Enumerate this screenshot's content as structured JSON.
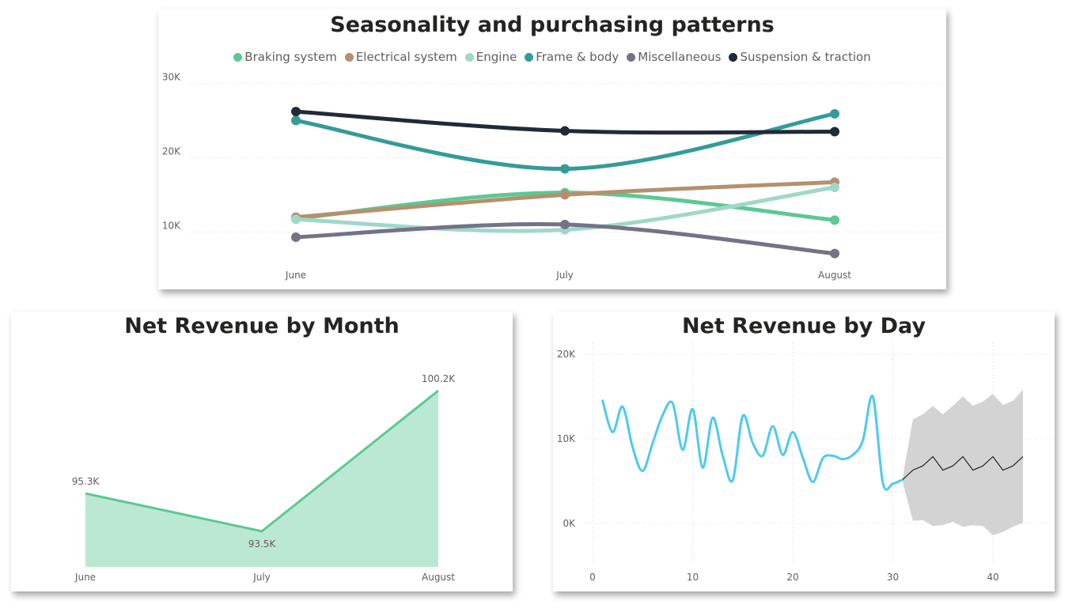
{
  "chart_data": [
    {
      "id": "seasonality",
      "type": "line",
      "title": "Seasonality and purchasing patterns",
      "categories": [
        "June",
        "July",
        "August"
      ],
      "yticks": [
        {
          "value": 10000,
          "label": "10K"
        },
        {
          "value": 20000,
          "label": "20K"
        },
        {
          "value": 30000,
          "label": "30K"
        }
      ],
      "ylim": [
        6000,
        31000
      ],
      "grid": true,
      "legend_position": "top-center",
      "series": [
        {
          "name": "Braking system",
          "color": "#5cc893",
          "values": [
            11800,
            15300,
            11600
          ]
        },
        {
          "name": "Electrical system",
          "color": "#b3916f",
          "values": [
            12000,
            15000,
            16700
          ]
        },
        {
          "name": "Engine",
          "color": "#a0d8c8",
          "values": [
            11700,
            10300,
            16000
          ]
        },
        {
          "name": "Frame & body",
          "color": "#339c97",
          "values": [
            25000,
            18500,
            25900
          ]
        },
        {
          "name": "Miscellaneous",
          "color": "#747386",
          "values": [
            9300,
            11000,
            7100
          ]
        },
        {
          "name": "Suspension & traction",
          "color": "#212b36",
          "values": [
            26200,
            23600,
            23500
          ]
        }
      ]
    },
    {
      "id": "month",
      "type": "area",
      "title": "Net Revenue by Month",
      "categories": [
        "June",
        "July",
        "August"
      ],
      "values": [
        95300,
        93500,
        100200
      ],
      "data_labels": [
        "95.3K",
        "93.5K",
        "100.2K"
      ],
      "ylim": [
        91800,
        100200
      ],
      "color": "#5cc893",
      "fill": "#bbe8d3"
    },
    {
      "id": "day",
      "type": "line",
      "title": "Net Revenue by Day",
      "xticks": [
        {
          "value": 0,
          "label": "0"
        },
        {
          "value": 10,
          "label": "10"
        },
        {
          "value": 20,
          "label": "20"
        },
        {
          "value": 30,
          "label": "30"
        },
        {
          "value": 40,
          "label": "40"
        }
      ],
      "yticks": [
        {
          "value": 0,
          "label": "0K"
        },
        {
          "value": 10000,
          "label": "10K"
        },
        {
          "value": 20000,
          "label": "20K"
        }
      ],
      "xlim": [
        0,
        43
      ],
      "ylim": [
        -6500,
        21000
      ],
      "grid": true,
      "actual": {
        "color": "#4ecaed",
        "x": [
          1,
          2,
          3,
          4,
          5,
          6,
          7,
          8,
          9,
          10,
          11,
          12,
          13,
          14,
          15,
          16,
          17,
          18,
          19,
          20,
          21,
          22,
          23,
          24,
          25,
          26,
          27,
          28,
          29,
          30,
          31
        ],
        "y": [
          14500,
          10800,
          13800,
          9000,
          6200,
          9500,
          12800,
          14200,
          8700,
          13500,
          6600,
          12500,
          8000,
          5100,
          12700,
          9500,
          8000,
          11500,
          8100,
          10800,
          7800,
          4900,
          7700,
          8000,
          7600,
          8100,
          9800,
          15000,
          4800,
          4700,
          5200
        ]
      },
      "forecast": {
        "color": "#252423",
        "band_color": "#d3d3d3",
        "x": [
          31,
          32,
          33,
          34,
          35,
          36,
          37,
          38,
          39,
          40,
          41,
          42,
          43
        ],
        "y": [
          5200,
          6300,
          6800,
          7900,
          6300,
          6800,
          7900,
          6300,
          6800,
          7900,
          6300,
          6800,
          7900
        ],
        "upper": [
          5600,
          12300,
          12900,
          13900,
          12900,
          13900,
          15000,
          13900,
          14400,
          15300,
          14000,
          14500,
          15800
        ],
        "lower": [
          4800,
          300,
          400,
          -300,
          -200,
          200,
          -400,
          -200,
          -300,
          -1400,
          -1000,
          -400,
          100
        ]
      }
    }
  ]
}
